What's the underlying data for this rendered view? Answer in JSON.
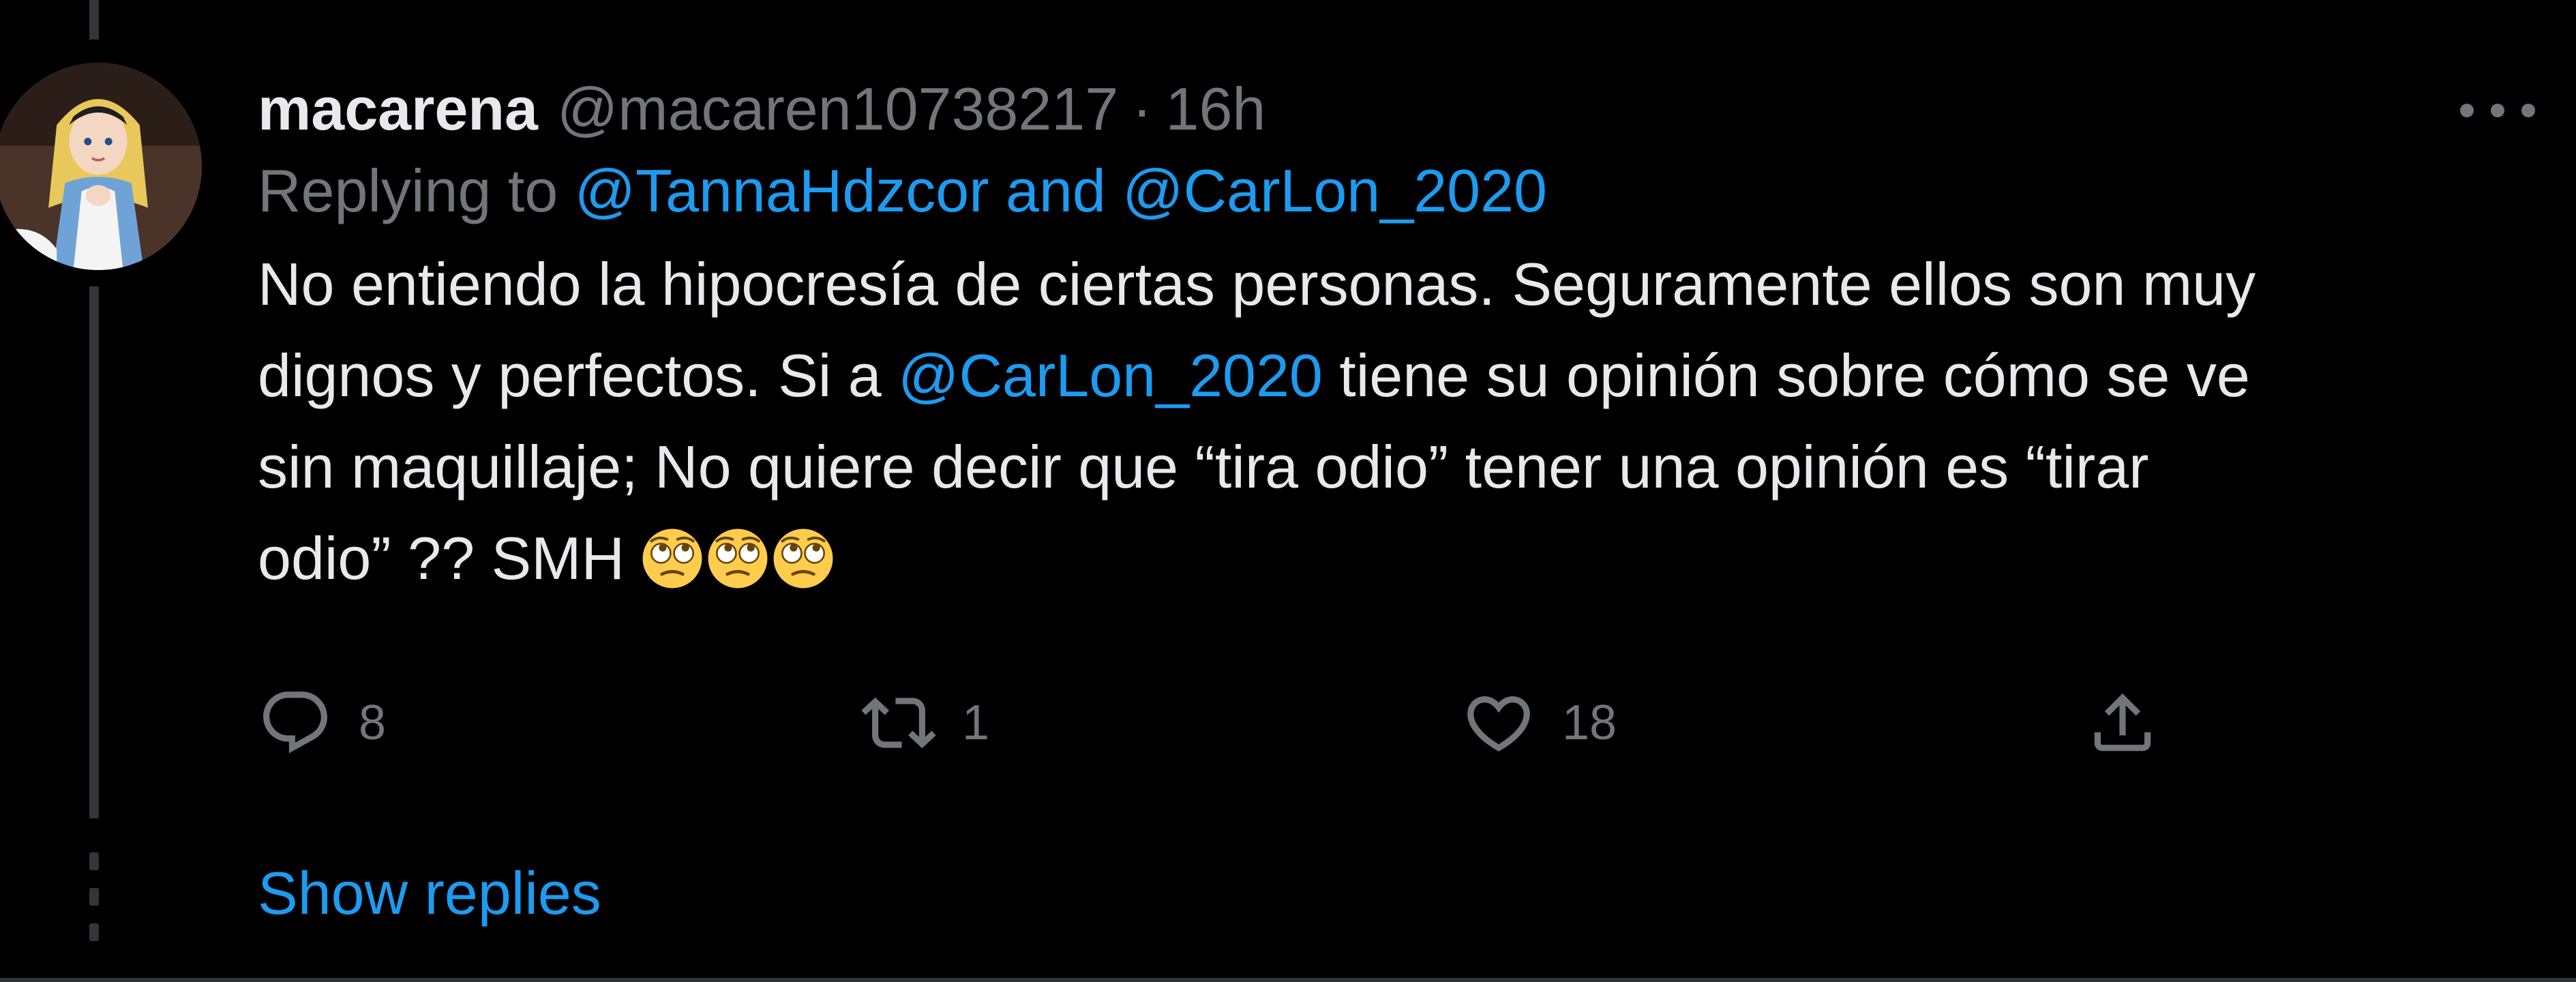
{
  "tweet": {
    "display_name": "macarena",
    "handle": "@macaren10738217",
    "separator": "·",
    "time": "16h",
    "replying_prefix": "Replying to ",
    "replying_user_1": "@TannaHdzcor",
    "replying_and": " and ",
    "replying_user_2": "@CarLon_2020",
    "body": {
      "line1": "No entiendo la hipocresía de ciertas personas. Seguramente ellos son muy",
      "line2_pre": "dignos y perfectos. Si a ",
      "line2_mention": "@CarLon_2020",
      "line2_post": " tiene su opinión sobre cómo se ve",
      "line3": "sin maquillaje; No quiere decir que “tira odio”  tener una opinión es “tirar",
      "line4": "odio” ?? SMH "
    },
    "emojis": [
      "face-with-rolling-eyes",
      "face-with-rolling-eyes",
      "face-with-rolling-eyes"
    ]
  },
  "actions": {
    "reply_count": "8",
    "retweet_count": "1",
    "like_count": "18"
  },
  "show_replies_label": "Show replies",
  "colors": {
    "background": "#000000",
    "text": "#e7e9ea",
    "secondary": "#71767b",
    "link": "#1d9bf0",
    "thread_line": "#333639"
  }
}
